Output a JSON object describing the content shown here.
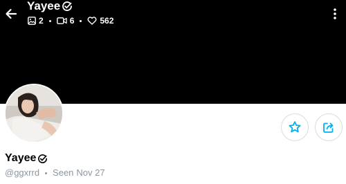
{
  "header": {
    "title": "Yayee",
    "stats": {
      "photos": "2",
      "videos": "6",
      "likes": "562"
    }
  },
  "profile": {
    "name": "Yayee",
    "handle": "@ggxrrd",
    "seen_label": "Seen",
    "seen_date": "Nov 27"
  },
  "icons": {
    "back": "arrow-left-icon",
    "verified": "verified-check-icon",
    "photos": "image-icon",
    "videos": "video-icon",
    "likes": "heart-icon",
    "more": "more-vertical-icon",
    "favorite": "star-icon",
    "share": "share-icon"
  },
  "colors": {
    "accent": "#00aff0",
    "cover_background": "#000000",
    "muted_text": "#8a96a3"
  }
}
